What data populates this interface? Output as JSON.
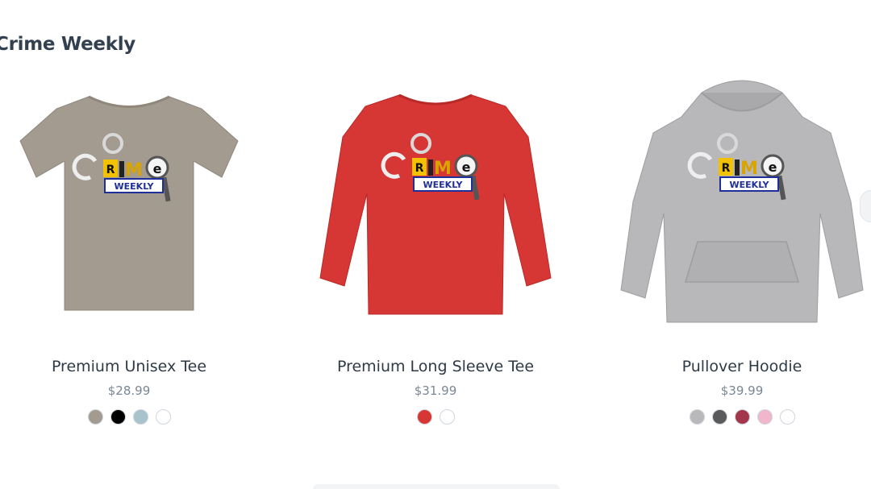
{
  "collection": {
    "title": "Crime Weekly"
  },
  "products": [
    {
      "name": "Premium Unisex Tee",
      "price": "$28.99",
      "garment": "tee-icon",
      "garment_color": "#a39b8f",
      "swatches": [
        "#a39b8f",
        "#000000",
        "#a9c3cc",
        "#ffffff"
      ]
    },
    {
      "name": "Premium Long Sleeve Tee",
      "price": "$31.99",
      "garment": "long-sleeve-icon",
      "garment_color": "#d63634",
      "swatches": [
        "#d63634",
        "#ffffff"
      ]
    },
    {
      "name": "Pullover Hoodie",
      "price": "$39.99",
      "garment": "hoodie-icon",
      "garment_color": "#b8b8ba",
      "swatches": [
        "#b9b9bb",
        "#5a5a5c",
        "#a3364a",
        "#efb6cc",
        "#ffffff"
      ]
    }
  ],
  "logo": {
    "line1": "CRIME",
    "line2": "WEEKLY"
  }
}
